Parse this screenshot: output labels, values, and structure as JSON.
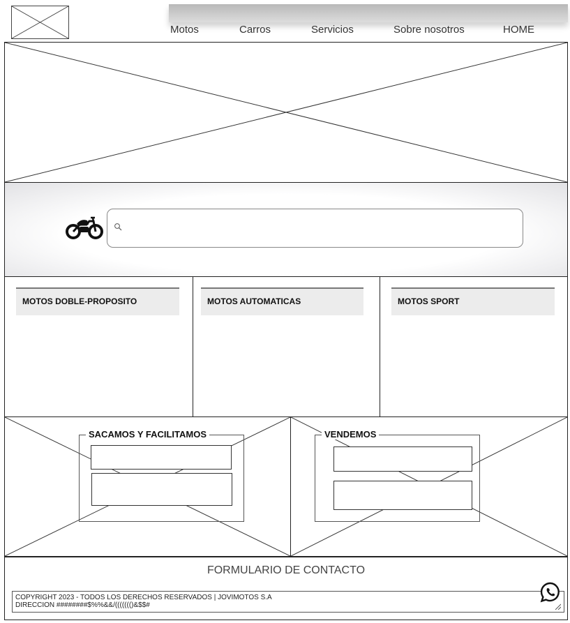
{
  "header": {
    "logo_alt": "",
    "nav": [
      {
        "label": "Motos"
      },
      {
        "label": "Carros"
      },
      {
        "label": "Servicios"
      },
      {
        "label": "Sobre nosotros"
      },
      {
        "label": "HOME"
      }
    ]
  },
  "search": {
    "placeholder": "",
    "icon": "motorcycle-icon"
  },
  "categories": [
    {
      "title": "MOTOS DOBLE-PROPOSITO"
    },
    {
      "title": "MOTOS AUTOMATICAS"
    },
    {
      "title": "MOTOS SPORT"
    }
  ],
  "promos": [
    {
      "legend": "SACAMOS Y FACILITAMOS"
    },
    {
      "legend": "VENDEMOS"
    }
  ],
  "footer": {
    "contact_title": "FORMULARIO DE CONTACTO",
    "copyright": "COPYRIGHT 2023 - TODOS LOS DERECHOS RESERVADOS | JOVIMOTOS S.A",
    "address": "DIRECCION ########$%%&&/((((((()&$$#",
    "whatsapp_icon": "whatsapp-icon"
  }
}
